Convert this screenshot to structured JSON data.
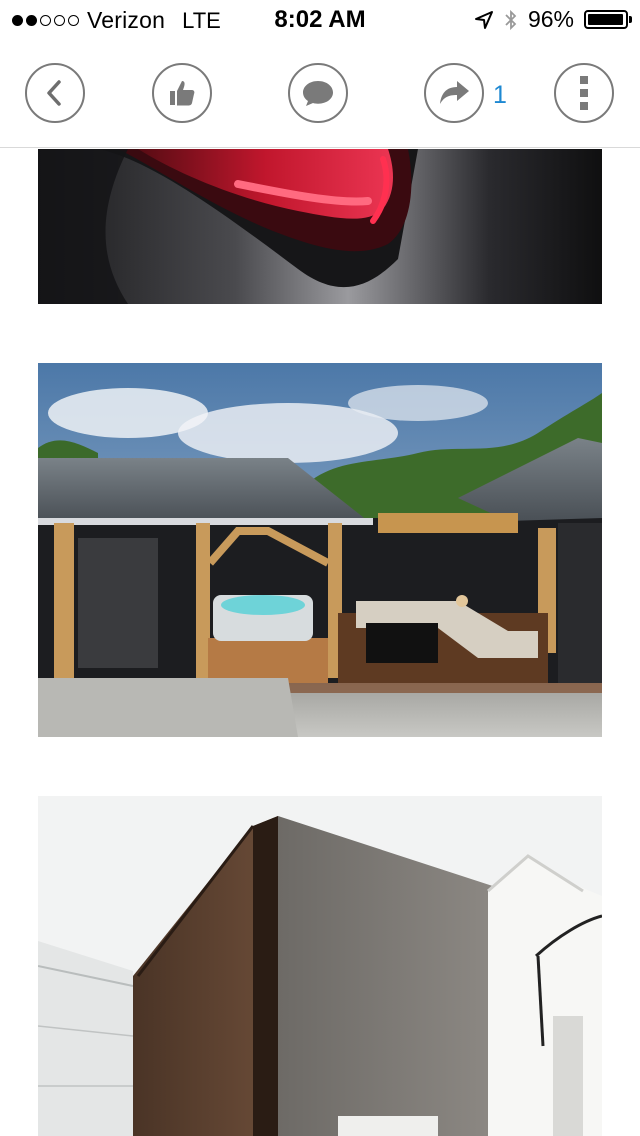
{
  "status_bar": {
    "signal_strength": 2,
    "carrier": "Verizon",
    "network": "LTE",
    "time": "8:02 AM",
    "battery_percent": "96%"
  },
  "toolbar": {
    "back_icon": "chevron-left-icon",
    "like_icon": "thumbs-up-icon",
    "comment_icon": "speech-bubble-icon",
    "share_icon": "share-arrow-icon",
    "share_count": "1",
    "more_icon": "vertical-dots-icon",
    "icon_color": "#7a7a7a",
    "accent": "#1e88d2"
  },
  "feed": {
    "images": [
      {
        "subject": "red-car-taillight"
      },
      {
        "subject": "outdoor-pavilion-hot-tub-lounge"
      },
      {
        "subject": "modern-concrete-building-facade"
      }
    ]
  }
}
